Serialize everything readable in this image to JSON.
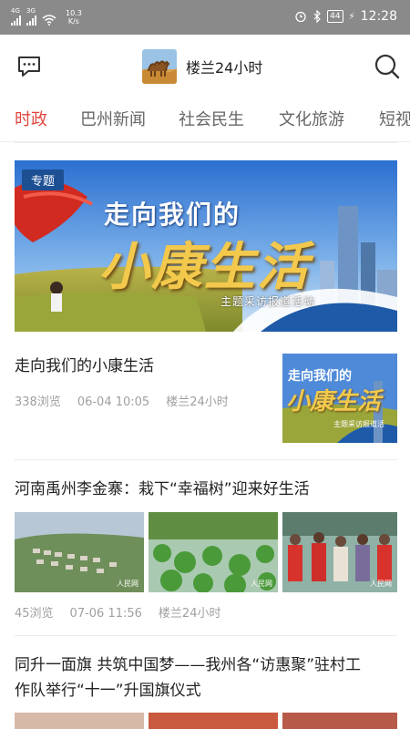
{
  "status_bar": {
    "sim1": "4G",
    "sim2": "3G",
    "net_speed_value": "10.3",
    "net_speed_unit": "K/s",
    "battery": "44",
    "time": "12:28"
  },
  "header": {
    "app_name": "楼兰24小时"
  },
  "tabs": [
    {
      "label": "时政",
      "active": true
    },
    {
      "label": "巴州新闻"
    },
    {
      "label": "社会民生"
    },
    {
      "label": "文化旅游"
    },
    {
      "label": "短视"
    }
  ],
  "banner": {
    "tag": "专题",
    "title_line1": "走向我们的",
    "title_line2": "小康生活",
    "subtitle": "主题采访报道活动"
  },
  "articles": [
    {
      "title": "走向我们的小康生活",
      "views": "338浏览",
      "time": "06-04 10:05",
      "source": "楼兰24小时",
      "thumb_title_line1": "走向我们的",
      "thumb_title_line2": "小康生活",
      "thumb_subtitle": "主题采访报道活"
    },
    {
      "title": "河南禹州李金寨：栽下“幸福树”迎来好生活",
      "views": "45浏览",
      "time": "07-06 11:56",
      "source": "楼兰24小时",
      "watermarks": [
        "人民网",
        "人民网",
        "人民网"
      ]
    },
    {
      "title_line1": "同升一面旗 共筑中国梦——我州各“访惠聚”驻村工",
      "title_line2": "作队举行“十一”升国旗仪式"
    }
  ],
  "colors": {
    "accent": "#e0473f",
    "status_bar": "#8a8a8a",
    "tag_bg": "#1d4f93"
  },
  "icons": [
    "message-icon",
    "search-icon",
    "wifi-icon",
    "alarm-icon",
    "bluetooth-icon",
    "battery-icon"
  ]
}
